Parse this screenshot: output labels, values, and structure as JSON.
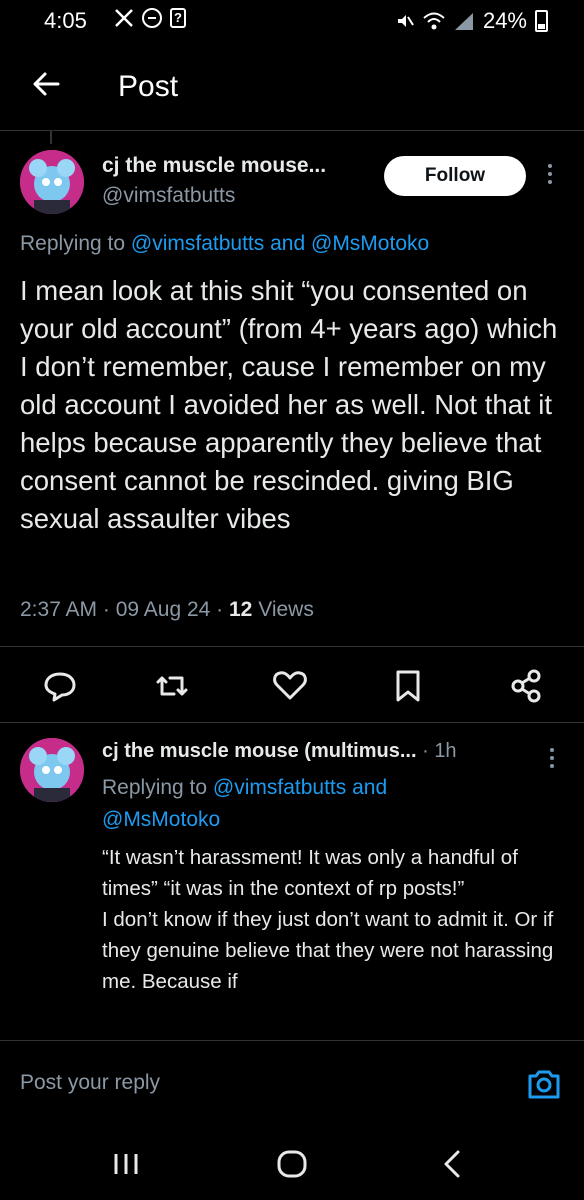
{
  "status_bar": {
    "time": "4:05",
    "battery": "24%",
    "icons": [
      "x-logo-icon",
      "do-not-disturb-icon",
      "notification-icon",
      "mute-icon",
      "wifi-icon",
      "signal-icon",
      "battery-icon"
    ]
  },
  "header": {
    "title": "Post",
    "back_icon": "arrow-left-icon"
  },
  "main_post": {
    "author_name": "cj the muscle mouse...",
    "handle": "@vimsfatbutts",
    "follow_label": "Follow",
    "replying_prefix": "Replying to",
    "replying_user1": "@vimsfatbutts",
    "replying_and": "and",
    "replying_user2": "@MsMotoko",
    "text": "I mean look at this shit “you consented on your old account” (from 4+ years ago) which I don’t remember, cause I remember on my old account I avoided her as well. Not that it helps because apparently they believe that consent cannot be rescinded. giving BIG sexual assaulter vibes",
    "time": "2:37 AM",
    "date": "09 Aug 24",
    "views_count": "12",
    "views_label": "Views",
    "actions": [
      "reply-icon",
      "repost-icon",
      "like-icon",
      "bookmark-icon",
      "share-icon"
    ]
  },
  "reply_post": {
    "author_name": "cj the muscle mouse (multimus...",
    "time": "1h",
    "replying_prefix": "Replying to",
    "replying_user1": "@vimsfatbutts",
    "replying_and": "and",
    "replying_user2": "@MsMotoko",
    "text": "“It wasn’t harassment! It was only a handful of times” “it was in the context of rp posts!”\nI don’t know if they just don’t want to admit it. Or if they genuine believe that they were not harassing me. Because if"
  },
  "reply_bar": {
    "placeholder": "Post your reply",
    "camera_icon": "camera-icon"
  },
  "nav_bar": {
    "icons": [
      "recent-apps-icon",
      "home-icon",
      "back-icon"
    ]
  },
  "colors": {
    "background": "#000000",
    "text_primary": "#e7e9ea",
    "text_secondary": "#8b98a5",
    "link": "#1d9bf0",
    "divider": "#2f3336",
    "avatar_bg": "#c62d8b"
  }
}
